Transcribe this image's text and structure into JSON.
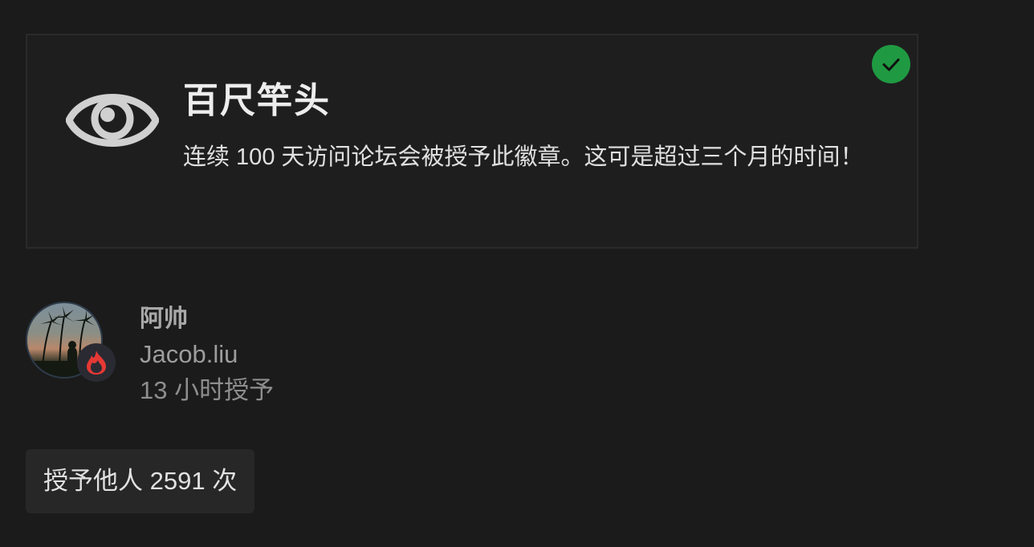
{
  "badge": {
    "title": "百尺竿头",
    "description": "连续 100 天访问论坛会被授予此徽章。这可是超过三个月的时间！",
    "icon": "eye-icon",
    "granted_icon": "check-icon",
    "granted_color": "#1f9a42"
  },
  "user": {
    "name": "阿帅",
    "username": "Jacob.liu",
    "granted_time": "13 小时授予",
    "flair_icon": "flame-icon",
    "flair_color": "#e53935"
  },
  "grant_count": {
    "label": "授予他人 2591 次"
  }
}
